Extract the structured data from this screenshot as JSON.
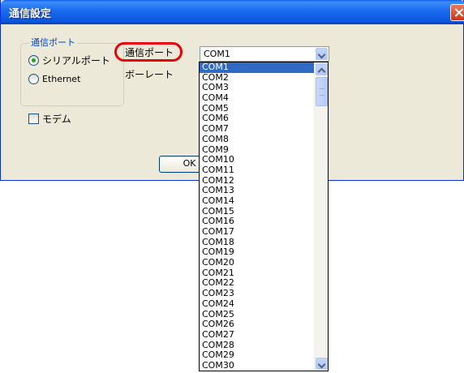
{
  "window": {
    "title": "通信設定"
  },
  "group": {
    "legend": "通信ポート",
    "serial_label": "シリアルポート",
    "ethernet_label": "Ethernet",
    "selected": "serial"
  },
  "modem": {
    "label": "モデム",
    "checked": false
  },
  "port": {
    "label": "通信ポート",
    "value": "COM1",
    "options": [
      "COM1",
      "COM2",
      "COM3",
      "COM4",
      "COM5",
      "COM6",
      "COM7",
      "COM8",
      "COM9",
      "COM10",
      "COM11",
      "COM12",
      "COM13",
      "COM14",
      "COM15",
      "COM16",
      "COM17",
      "COM18",
      "COM19",
      "COM20",
      "COM21",
      "COM22",
      "COM23",
      "COM24",
      "COM25",
      "COM26",
      "COM27",
      "COM28",
      "COM29",
      "COM30"
    ]
  },
  "baud": {
    "label": "ボーレート"
  },
  "buttons": {
    "ok_label": "OK"
  },
  "colors": {
    "highlight": "#e8000b",
    "accent": "#316ac5"
  }
}
